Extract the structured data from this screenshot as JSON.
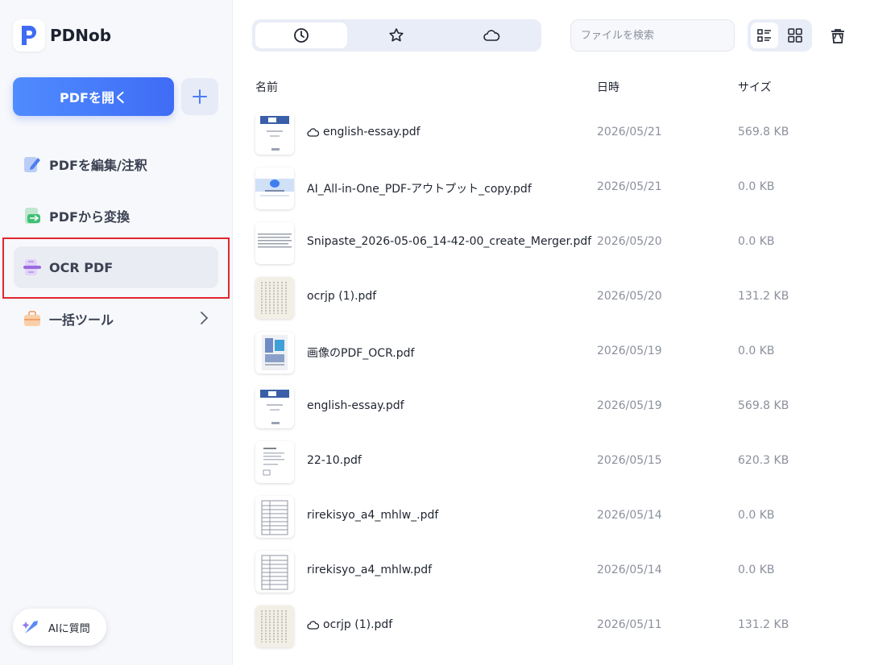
{
  "app": {
    "name": "PDNob"
  },
  "sidebar": {
    "open_label": "PDFを開く",
    "items": [
      {
        "label": "PDFを編集/注釈",
        "icon": "edit-icon"
      },
      {
        "label": "PDFから変換",
        "icon": "convert-icon"
      },
      {
        "label": "OCR PDF",
        "icon": "ocr-icon",
        "active": true
      },
      {
        "label": "一括ツール",
        "icon": "toolbox-icon",
        "has_submenu": true
      }
    ],
    "ai_label": "AIに質問"
  },
  "toolbar": {
    "tabs": [
      {
        "icon": "clock-icon",
        "active": true
      },
      {
        "icon": "star-icon"
      },
      {
        "icon": "cloud-icon"
      }
    ],
    "search_placeholder": "ファイルを検索",
    "view_modes": [
      {
        "icon": "list-view-icon",
        "active": true
      },
      {
        "icon": "grid-view-icon"
      }
    ],
    "trash_icon": "trash-icon"
  },
  "table": {
    "headers": {
      "name": "名前",
      "date": "日時",
      "size": "サイズ"
    },
    "rows": [
      {
        "name": "english-essay.pdf",
        "date": "2026/05/21",
        "size": "569.8 KB",
        "cloud": true,
        "thumb": "blue-header"
      },
      {
        "name": "AI_All-in-One_PDF-アウトプット_copy.pdf",
        "date": "2026/05/21",
        "size": "0.0 KB",
        "cloud": false,
        "thumb": "blue-banner"
      },
      {
        "name": "Snipaste_2026-05-06_14-42-00_create_Merger.pdf",
        "date": "2026/05/20",
        "size": "0.0 KB",
        "cloud": false,
        "thumb": "text-lines"
      },
      {
        "name": "ocrjp (1).pdf",
        "date": "2026/05/20",
        "size": "131.2 KB",
        "cloud": false,
        "thumb": "vertical-text"
      },
      {
        "name": "画像のPDF_OCR.pdf",
        "date": "2026/05/19",
        "size": "0.0 KB",
        "cloud": false,
        "thumb": "image-doc"
      },
      {
        "name": "english-essay.pdf",
        "date": "2026/05/19",
        "size": "569.8 KB",
        "cloud": false,
        "thumb": "blue-header"
      },
      {
        "name": "22-10.pdf",
        "date": "2026/05/15",
        "size": "620.3 KB",
        "cloud": false,
        "thumb": "form"
      },
      {
        "name": "rirekisyo_a4_mhlw_.pdf",
        "date": "2026/05/14",
        "size": "0.0 KB",
        "cloud": false,
        "thumb": "table"
      },
      {
        "name": "rirekisyo_a4_mhlw.pdf",
        "date": "2026/05/14",
        "size": "0.0 KB",
        "cloud": false,
        "thumb": "table"
      },
      {
        "name": "ocrjp (1).pdf",
        "date": "2026/05/11",
        "size": "131.2 KB",
        "cloud": true,
        "thumb": "vertical-text"
      }
    ]
  },
  "colors": {
    "accent": "#3f6cf5",
    "highlight": "#e0262f"
  }
}
